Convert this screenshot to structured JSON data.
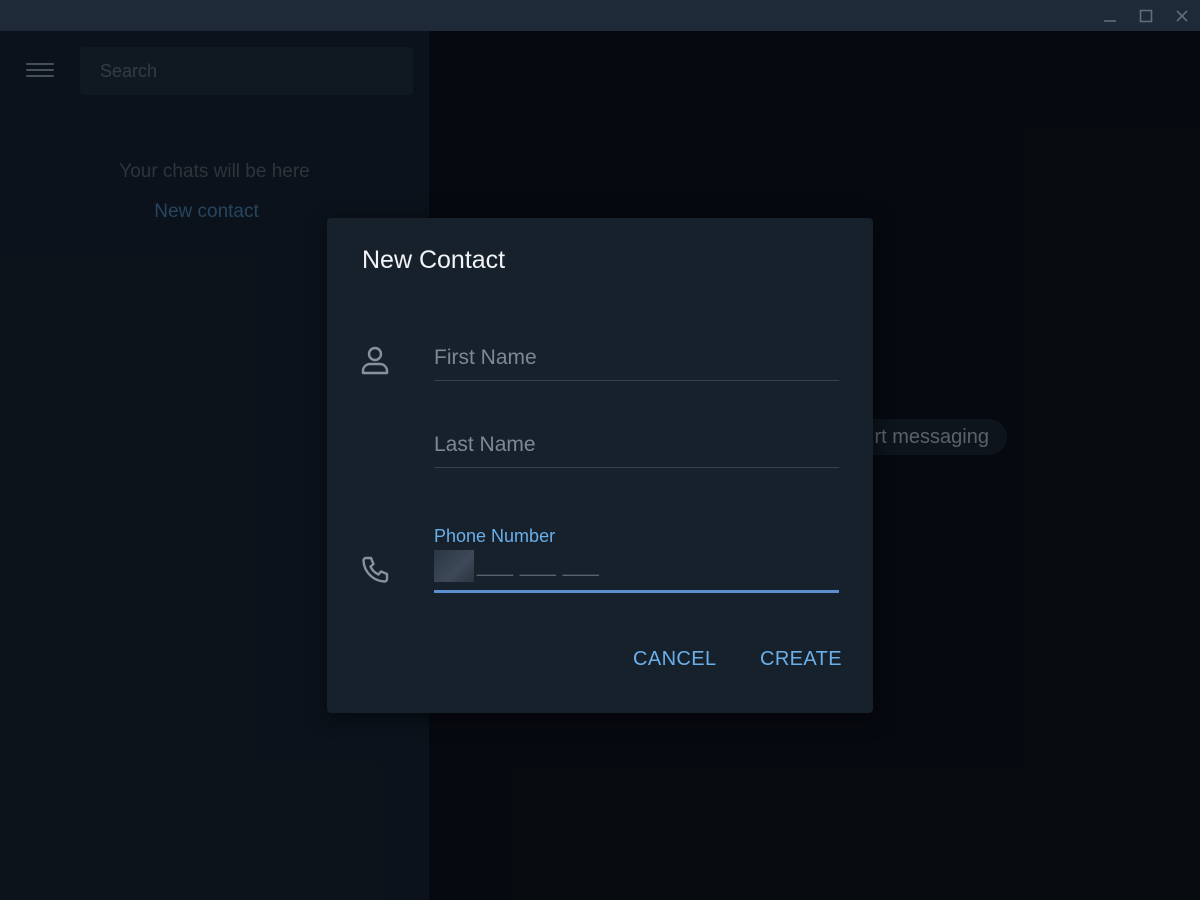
{
  "sidebar": {
    "search_placeholder": "Search",
    "empty_text": "Your chats will be here",
    "new_contact_link": "New contact"
  },
  "main": {
    "start_messaging": "rt messaging"
  },
  "dialog": {
    "title": "New Contact",
    "first_name_placeholder": "First Name",
    "last_name_placeholder": "Last Name",
    "phone_label": "Phone Number",
    "phone_mask": "___ ___ ___",
    "cancel_label": "CANCEL",
    "create_label": "CREATE"
  },
  "icons": {
    "person": "person-icon",
    "phone": "phone-icon"
  },
  "colors": {
    "accent": "#6aaeea",
    "dialog_bg": "#17212b",
    "sidebar_bg": "#121d2a",
    "main_bg": "#0a0f17"
  }
}
